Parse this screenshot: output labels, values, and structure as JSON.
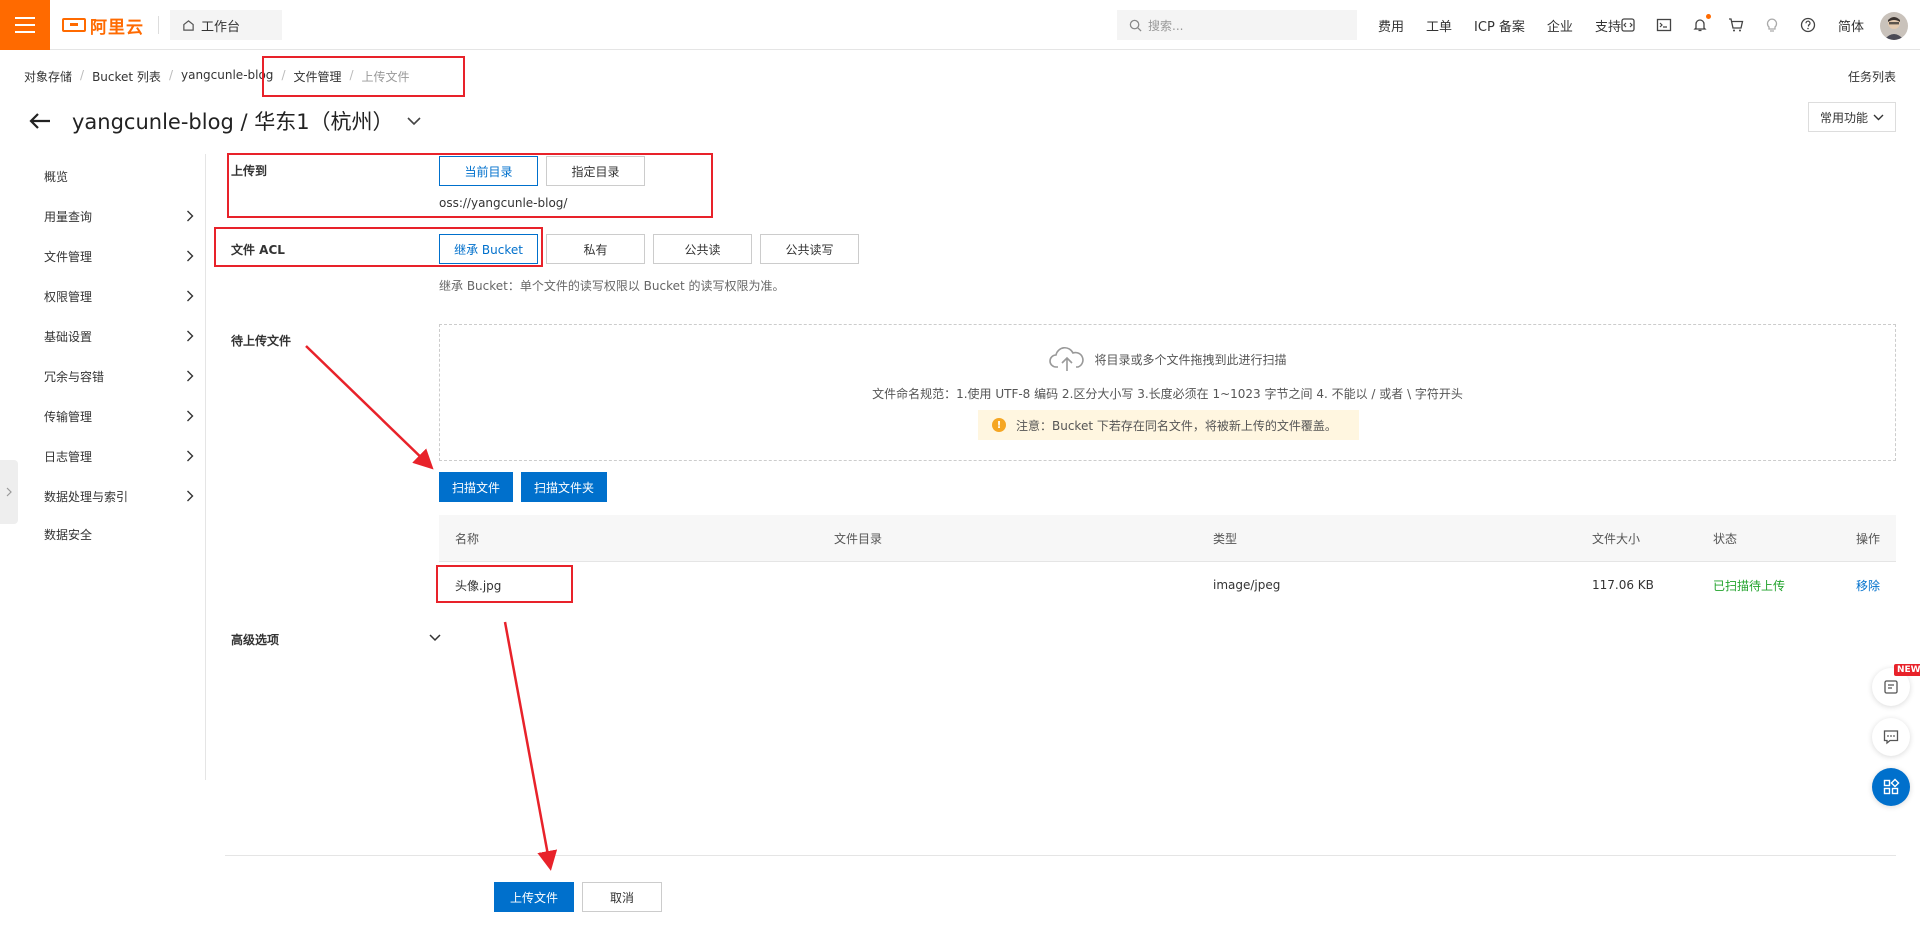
{
  "topbar": {
    "logo_text": "阿里云",
    "workbench": "工作台",
    "search_placeholder": "搜索...",
    "nav": [
      "费用",
      "工单",
      "ICP 备案",
      "企业",
      "支持"
    ],
    "lang": "简体"
  },
  "breadcrumb": {
    "items": [
      "对象存储",
      "Bucket 列表",
      "yangcunle-blog",
      "文件管理"
    ],
    "current": "上传文件"
  },
  "tasklist": "任务列表",
  "title": "yangcunle-blog / 华东1（杭州）",
  "common_functions": "常用功能",
  "sidebar": {
    "items": [
      "概览",
      "用量查询",
      "文件管理",
      "权限管理",
      "基础设置",
      "冗余与容错",
      "传输管理",
      "日志管理",
      "数据处理与索引",
      "数据安全"
    ]
  },
  "form": {
    "upload_to_label": "上传到",
    "upload_to_options": [
      "当前目录",
      "指定目录"
    ],
    "upload_path": "oss://yangcunle-blog/",
    "acl_label": "文件 ACL",
    "acl_options": [
      "继承 Bucket",
      "私有",
      "公共读",
      "公共读写"
    ],
    "acl_hint": "继承 Bucket：单个文件的读写权限以 Bucket 的读写权限为准。",
    "pending_label": "待上传文件",
    "dropzone_text": "将目录或多个文件拖拽到此进行扫描",
    "naming_rule": "文件命名规范：1.使用 UTF-8 编码 2.区分大小写 3.长度必须在 1~1023 字节之间 4. 不能以 / 或者 \\ 字符开头",
    "notice": "注意：Bucket 下若存在同名文件，将被新上传的文件覆盖。",
    "scan_file": "扫描文件",
    "scan_folder": "扫描文件夹",
    "advanced_label": "高级选项"
  },
  "table": {
    "headers": [
      "名称",
      "文件目录",
      "类型",
      "文件大小",
      "状态",
      "操作"
    ],
    "rows": [
      {
        "name": "头像.jpg",
        "dir": "",
        "type": "image/jpeg",
        "size": "117.06 KB",
        "status": "已扫描待上传",
        "action": "移除"
      }
    ]
  },
  "footer": {
    "upload": "上传文件",
    "cancel": "取消"
  },
  "colors": {
    "brand": "#ff6a00",
    "primary": "#0070cc",
    "success": "#22a32c",
    "annotation": "#e8222a"
  },
  "badge_new": "NEW"
}
